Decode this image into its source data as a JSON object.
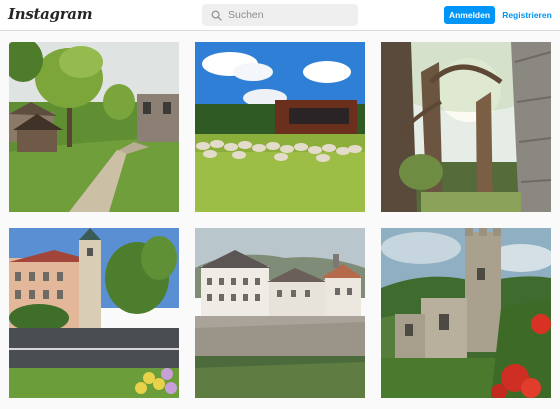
{
  "header": {
    "logo": "Instagram",
    "search_placeholder": "Suchen",
    "login_label": "Anmelden",
    "register_label": "Registrieren"
  },
  "icons": {
    "search": "search-icon"
  },
  "colors": {
    "accent": "#0095f6",
    "background": "#fafafa",
    "header_border": "#dbdbdb"
  },
  "posts": [
    {
      "subject": "park-with-pavilion"
    },
    {
      "subject": "sheep-field-modern-building"
    },
    {
      "subject": "stone-tree-sculpture"
    },
    {
      "subject": "town-street-church-tower"
    },
    {
      "subject": "castle-with-moat"
    },
    {
      "subject": "castle-ruin-with-poppies"
    }
  ]
}
